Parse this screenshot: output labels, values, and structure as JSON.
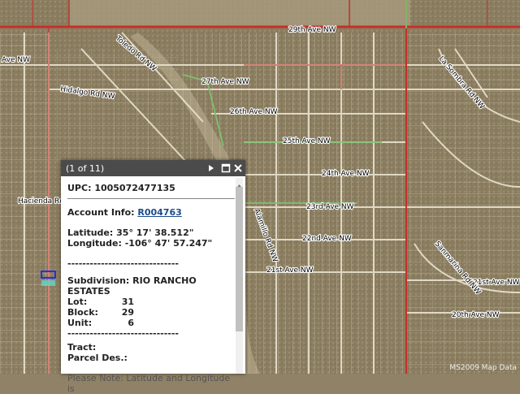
{
  "map": {
    "roads": [
      "29th Ave NW",
      "27th Ave NW",
      "26th Ave NW",
      "25th Ave NW",
      "24th Ave NW",
      "23rd Ave NW",
      "22nd Ave NW",
      "21st Ave NW",
      "21st Ave NW",
      "20th Ave NW",
      "Toledo Rd NW",
      "Hidalgo Rd NW",
      "Hacienda Rd",
      "La Sombra Rd NW",
      "Sanmarina Rd NW",
      "Alamillo Rd NW",
      "Ave NW"
    ],
    "watermark": "MS2009 Map Data"
  },
  "popup": {
    "count": "(1 of 11)",
    "upc_label": "UPC:",
    "upc_value": "1005072477135",
    "account_label": "Account Info:",
    "account_value": "R004763",
    "latitude_label": "Latitude:",
    "latitude_value": "35° 17' 38.512\"",
    "longitude_label": "Longitude:",
    "longitude_value": "-106° 47' 57.247\"",
    "dashes": "------------------------------",
    "subdivision_label": "Subdivision:",
    "subdivision_value": "RIO RANCHO ESTATES",
    "lot_label": "Lot:",
    "lot_value": "31",
    "block_label": "Block:",
    "block_value": "29",
    "unit_label": "Unit:",
    "unit_value": "6",
    "tract_label": "Tract:",
    "parcel_label": "Parcel Des.:",
    "note": "Please Note: Latitude and Longitude is"
  }
}
